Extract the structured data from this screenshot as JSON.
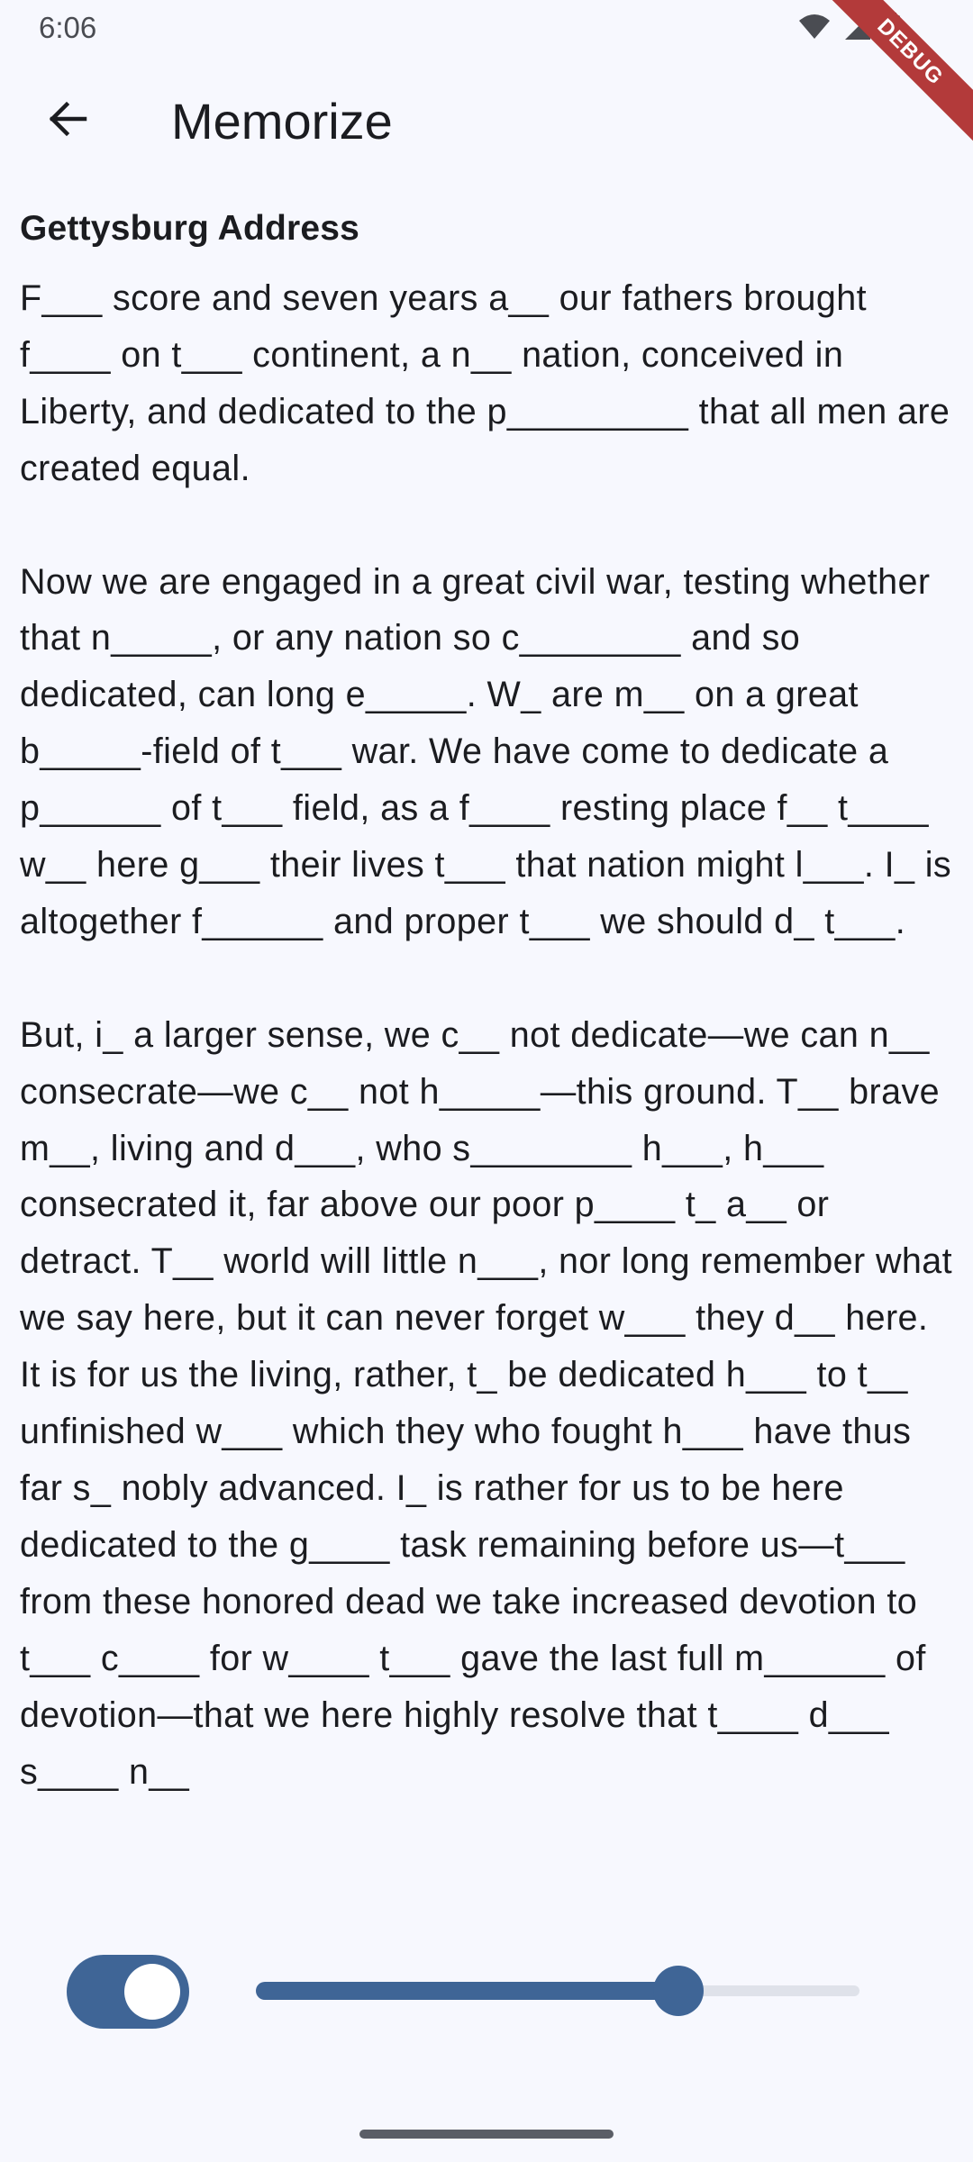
{
  "status_bar": {
    "time": "6:06",
    "icons": [
      "wifi-icon",
      "signal-icon",
      "battery-icon"
    ]
  },
  "debug_banner": {
    "label": "DEBUG",
    "color": "#b33a3a"
  },
  "app_bar": {
    "back_icon": "arrow-back-icon",
    "title": "Memorize"
  },
  "document": {
    "title": "Gettysburg Address",
    "paragraphs": [
      "F___ score and seven years a__ our fathers brought f____ on t___ continent, a n__ nation, conceived in Liberty, and dedicated to the p_________ that all men are created equal.",
      "Now we are engaged in a great civil war, testing whether that n_____, or any nation so c________ and so dedicated, can long e_____. W_ are m__ on a great b_____-field of t___ war. We have come to dedicate a p______ of t___ field, as a f____ resting place f__ t____ w__ here g___ their lives t___ that nation might l___. I_ is altogether f______ and proper t___ we should d_ t___.",
      "But, i_ a larger sense, we c__ not dedicate—we can n__ consecrate—we c__ not h_____—this ground. T__ brave m__, living and d___, who s________ h___, h___ consecrated it, far above our poor p____ t_ a__ or detract. T__ world will little n___, nor long remember what we say here, but it can never forget w___ they d__ here. It is for us the living, rather, t_ be dedicated h___ to t__ unfinished w___ which they who fought h___ have thus far s_ nobly advanced. I_ is rather for us to be here dedicated to the g____ task remaining before us—t___ from these honored dead we take increased devotion to t___ c____ for w____ t___ gave the last full m______ of devotion—that we here highly resolve that t____ d___ s____ n__"
    ]
  },
  "controls": {
    "toggle_on": true,
    "slider_fraction": 0.7,
    "accent_color": "#3f6596"
  }
}
